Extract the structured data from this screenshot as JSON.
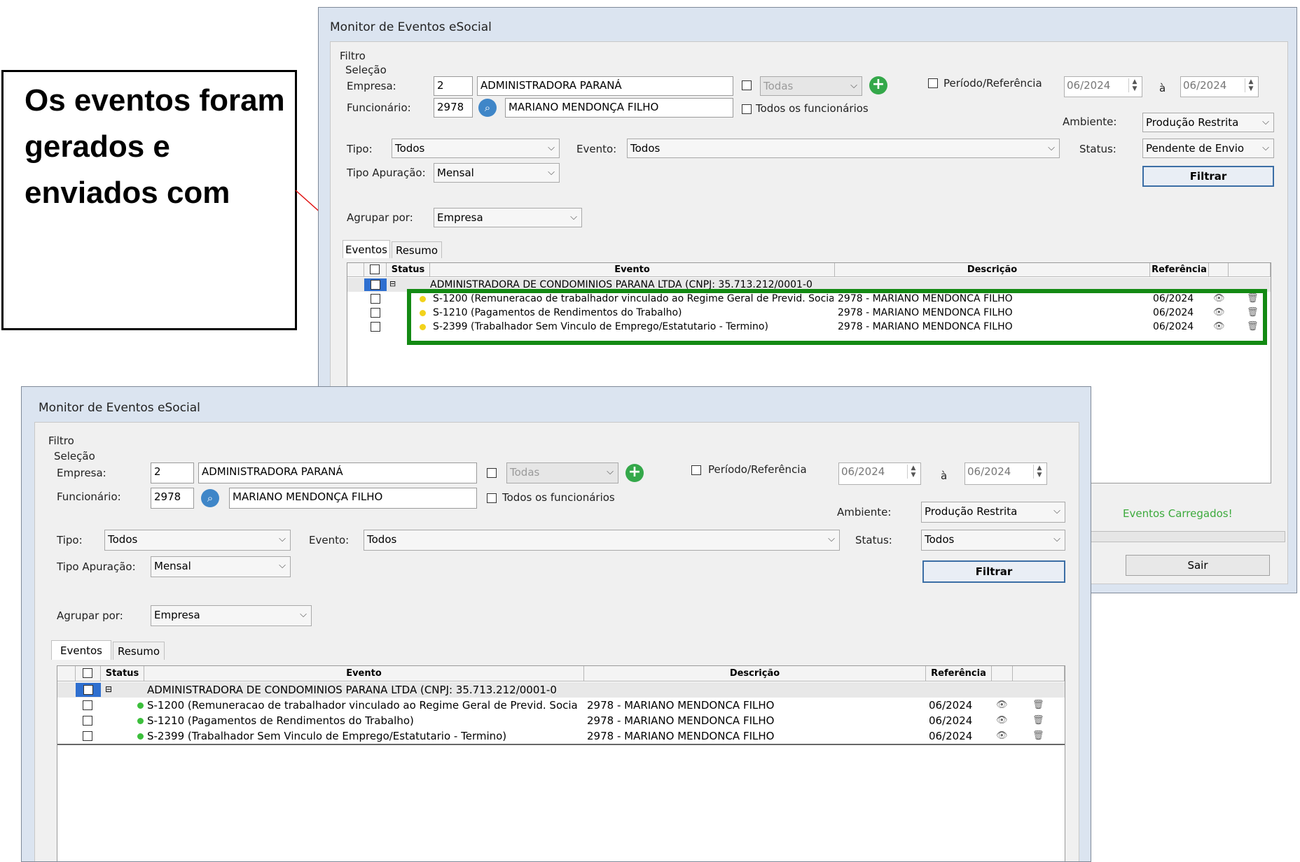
{
  "callout": {
    "text": "Os eventos foram gerados e enviados com"
  },
  "before": {
    "title": "Monitor de Eventos eSocial",
    "filtro": "Filtro",
    "selecao": "Seleção",
    "empresa_label": "Empresa:",
    "empresa_code": "2",
    "empresa_name": "ADMINISTRADORA PARANÁ",
    "todas": "Todas",
    "funcionario_label": "Funcionário:",
    "funcionario_code": "2978",
    "funcionario_name": "MARIANO MENDONÇA FILHO",
    "todos_funcionarios": "Todos os funcionários",
    "periodo": "Período/Referência",
    "periodo_from": "06/2024",
    "periodo_sep": "à",
    "periodo_to": "06/2024",
    "ambiente_label": "Ambiente:",
    "ambiente": "Produção Restrita",
    "tipo_label": "Tipo:",
    "tipo": "Todos",
    "evento_label": "Evento:",
    "evento": "Todos",
    "status_label": "Status:",
    "status": "Pendente de Envio",
    "filtrar": "Filtrar",
    "apuracao_label": "Tipo Apuração:",
    "apuracao": "Mensal",
    "agrupar_label": "Agrupar por:",
    "agrupar": "Empresa",
    "tabs": [
      "Eventos",
      "Resumo"
    ],
    "columns": [
      "Status",
      "Evento",
      "Descrição",
      "Referência"
    ],
    "group": "ADMINISTRADORA DE CONDOMINIOS PARANA LTDA (CNPJ: 35.713.212/0001-0",
    "rows": [
      {
        "evento": "S-1200 (Remuneracao de trabalhador vinculado ao Regime Geral de Previd. Socia",
        "desc": "2978 - MARIANO MENDONCA FILHO",
        "ref": "06/2024"
      },
      {
        "evento": "S-1210 (Pagamentos de Rendimentos do Trabalho)",
        "desc": "2978 - MARIANO MENDONCA FILHO",
        "ref": "06/2024"
      },
      {
        "evento": "S-2399 (Trabalhador Sem Vinculo de Emprego/Estatutario - Termino)",
        "desc": "2978 - MARIANO MENDONCA FILHO",
        "ref": "06/2024"
      }
    ],
    "loaded_msg": "Eventos Carregados!",
    "sair": "Sair",
    "status_dot_color": "#f2d21b"
  },
  "after": {
    "title": "Monitor de Eventos eSocial",
    "filtro": "Filtro",
    "selecao": "Seleção",
    "empresa_label": "Empresa:",
    "empresa_code": "2",
    "empresa_name": "ADMINISTRADORA PARANÁ",
    "todas": "Todas",
    "funcionario_label": "Funcionário:",
    "funcionario_code": "2978",
    "funcionario_name": "MARIANO MENDONÇA FILHO",
    "todos_funcionarios": "Todos os funcionários",
    "periodo": "Período/Referência",
    "periodo_from": "06/2024",
    "periodo_sep": "à",
    "periodo_to": "06/2024",
    "ambiente_label": "Ambiente:",
    "ambiente": "Produção Restrita",
    "tipo_label": "Tipo:",
    "tipo": "Todos",
    "evento_label": "Evento:",
    "evento": "Todos",
    "status_label": "Status:",
    "status": "Todos",
    "filtrar": "Filtrar",
    "apuracao_label": "Tipo Apuração:",
    "apuracao": "Mensal",
    "agrupar_label": "Agrupar por:",
    "agrupar": "Empresa",
    "tabs": [
      "Eventos",
      "Resumo"
    ],
    "columns": [
      "Status",
      "Evento",
      "Descrição",
      "Referência"
    ],
    "group": "ADMINISTRADORA DE CONDOMINIOS PARANA LTDA (CNPJ: 35.713.212/0001-0",
    "rows": [
      {
        "evento": "S-1200 (Remuneracao de trabalhador vinculado ao Regime Geral de Previd. Socia",
        "desc": "2978 - MARIANO MENDONCA FILHO",
        "ref": "06/2024"
      },
      {
        "evento": "S-1210 (Pagamentos de Rendimentos do Trabalho)",
        "desc": "2978 - MARIANO MENDONCA FILHO",
        "ref": "06/2024"
      },
      {
        "evento": "S-2399 (Trabalhador Sem Vinculo de Emprego/Estatutario - Termino)",
        "desc": "2978 - MARIANO MENDONCA FILHO",
        "ref": "06/2024"
      }
    ],
    "status_dot_color": "#3cbf3c"
  },
  "colors": {
    "highlight": "#138a13",
    "arrow": "#e01010",
    "selection": "#2e6fd0"
  },
  "icons": [
    "plus-icon",
    "search-icon",
    "eye-icon",
    "trash-icon",
    "chevron-down-icon",
    "collapse-icon"
  ]
}
